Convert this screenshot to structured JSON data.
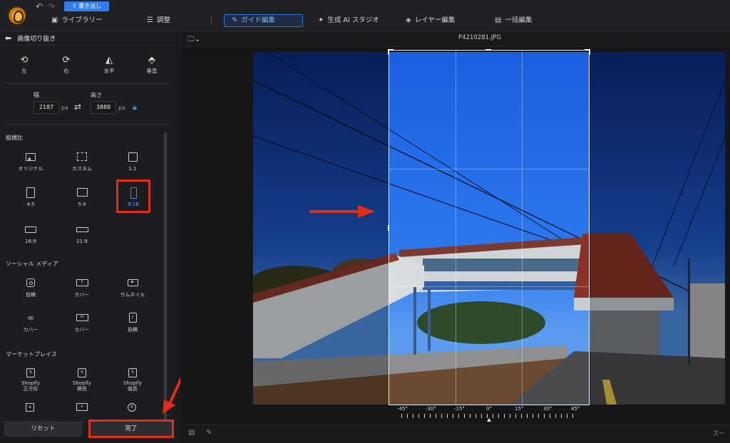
{
  "toolbar": {
    "undo_icon": "undo-icon",
    "redo_icon": "redo-icon",
    "export_label": "書き出し"
  },
  "tabs": [
    {
      "label": "ライブラリー",
      "icon": "library-icon"
    },
    {
      "label": "調整",
      "icon": "sliders-icon"
    },
    {
      "label": "ガイド編集",
      "icon": "wand-icon",
      "active": true
    },
    {
      "label": "生成 AI スタジオ",
      "icon": "sparkle-icon"
    },
    {
      "label": "レイヤー編集",
      "icon": "layers-icon"
    },
    {
      "label": "一括編集",
      "icon": "batch-icon"
    }
  ],
  "panel": {
    "title": "画像切り抜き",
    "rotate_flip": [
      {
        "label": "左",
        "icon": "rotate-left-icon"
      },
      {
        "label": "右",
        "icon": "rotate-right-icon"
      },
      {
        "label": "水平",
        "icon": "flip-horizontal-icon"
      },
      {
        "label": "垂直",
        "icon": "flip-vertical-icon"
      }
    ],
    "width_label": "幅",
    "height_label": "高さ",
    "width_value": "2187",
    "height_value": "3888",
    "unit": "px",
    "aspect_section": "縦横比",
    "aspect_options": [
      {
        "label": "オリジナル"
      },
      {
        "label": "カスタム"
      },
      {
        "label": "1:1"
      },
      {
        "label": "4:5"
      },
      {
        "label": "5:4"
      },
      {
        "label": "9:16",
        "selected": true
      },
      {
        "label": "16:9"
      },
      {
        "label": "21:9"
      }
    ],
    "social_section": "ソーシャル メディア",
    "social_options": [
      {
        "label": "投稿"
      },
      {
        "label": "カバー"
      },
      {
        "label": "サムネイル"
      },
      {
        "label": "カバー"
      },
      {
        "label": "カバー"
      },
      {
        "label": "投稿"
      }
    ],
    "market_section": "マーケットプレイス",
    "market_options": [
      {
        "label": "Shopify\n正方形"
      },
      {
        "label": "Shopify\n横長"
      },
      {
        "label": "Shopify\n縦長"
      }
    ],
    "reset_label": "リセット",
    "done_label": "完了"
  },
  "canvas": {
    "filename": "P4210281.JPG",
    "rotation_ticks": [
      "-45°",
      "-30°",
      "-15°",
      "0°",
      "15°",
      "30°",
      "45°"
    ],
    "zoom_label": "ズー"
  },
  "colors": {
    "accent": "#2f7ef0",
    "highlight": "#e22d18"
  }
}
